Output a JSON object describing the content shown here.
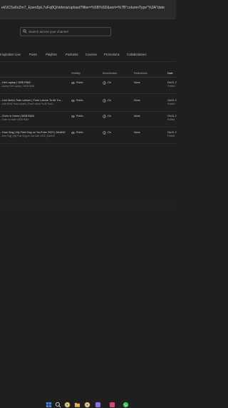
{
  "browser": {
    "url": "el/UC5a6xZm7_Epen5pL7uFq8Q/videos/upload?filter=%5B%5D&sort=%7B\"columnType\"%3A\"date"
  },
  "search": {
    "placeholder": "Search across your channel"
  },
  "tabs": [
    {
      "label": "Inspiration"
    },
    {
      "label": "Live"
    },
    {
      "label": "Posts"
    },
    {
      "label": "Playlists"
    },
    {
      "label": "Podcasts"
    },
    {
      "label": "Courses"
    },
    {
      "label": "Promotions"
    },
    {
      "label": "Collaborations"
    }
  ],
  "columns": {
    "visibility": "Visibility",
    "monetization": "Monetization",
    "restrictions": "Restrictions",
    "date": "Date"
  },
  "rows": [
    {
      "title": "...Dell Laptop | 8GB RAM",
      "desc": "...Laptop Dell Laptop | 16GB RAM",
      "visibility": "Public",
      "monetization": "On",
      "restrictions": "None",
      "date": "Oct 8, 2",
      "date_sub": "Publish"
    },
    {
      "title": "...Link Metro Train Lahore | From Lahore To All Tra...",
      "desc": "...Link Metro Train Lahore | From Lahore To All Train...",
      "visibility": "Public",
      "monetization": "On",
      "restrictions": "None",
      "date": "Oct 8, 2",
      "date_sub": "Publish"
    },
    {
      "title": "...Oven in Home | 8GB RAM",
      "desc": "...Oven in Home | 8GB RAM",
      "visibility": "Public",
      "monetization": "On",
      "restrictions": "None",
      "date": "Oct 8, 2",
      "date_sub": "Publish"
    },
    {
      "title": "...How Vlog | My First Vlog on YouTube 2023 | DAANS",
      "desc": "...New Vlog | My First Vlog on YouTube 2023 | DAANS",
      "visibility": "Public",
      "monetization": "On",
      "restrictions": "None",
      "date": "Oct 8, 2",
      "date_sub": "Publish"
    }
  ],
  "taskbar": {
    "icons": [
      "windows-icon",
      "search-icon",
      "chrome-icon",
      "folder-icon",
      "chrome-icon",
      "app-icon",
      "app-icon",
      "whatsapp-icon"
    ],
    "colors": [
      "#2f88ff",
      "#d6d6d6",
      "#e8b64c",
      "#e3b341",
      "#e8b64c",
      "#8a6fd8",
      "#d04a7a",
      "#39c35a"
    ]
  }
}
